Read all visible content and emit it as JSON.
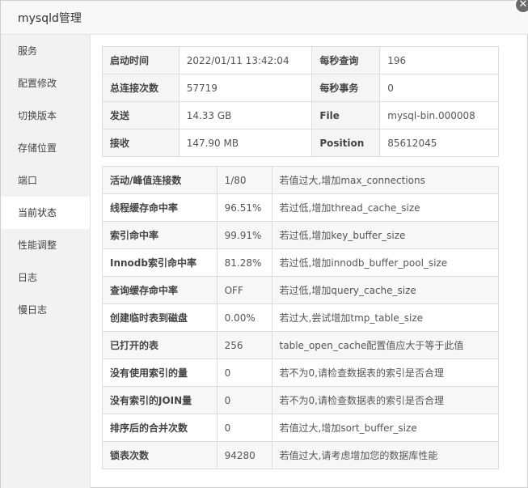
{
  "title": "mysqld管理",
  "close_glyph": "✕",
  "sidebar": {
    "items": [
      {
        "label": "服务"
      },
      {
        "label": "配置修改"
      },
      {
        "label": "切换版本"
      },
      {
        "label": "存储位置"
      },
      {
        "label": "端口"
      },
      {
        "label": "当前状态"
      },
      {
        "label": "性能调整"
      },
      {
        "label": "日志"
      },
      {
        "label": "慢日志"
      }
    ],
    "active_index": 5
  },
  "summary": [
    [
      "启动时间",
      "2022/01/11 13:42:04",
      "每秒查询",
      "196"
    ],
    [
      "总连接次数",
      "57719",
      "每秒事务",
      "0"
    ],
    [
      "发送",
      "14.33 GB",
      "File",
      "mysql-bin.000008"
    ],
    [
      "接收",
      "147.90 MB",
      "Position",
      "85612045"
    ]
  ],
  "metrics": [
    [
      "活动/峰值连接数",
      "1/80",
      "若值过大,增加max_connections"
    ],
    [
      "线程缓存命中率",
      "96.51%",
      "若过低,增加thread_cache_size"
    ],
    [
      "索引命中率",
      "99.91%",
      "若过低,增加key_buffer_size"
    ],
    [
      "Innodb索引命中率",
      "81.28%",
      "若过低,增加innodb_buffer_pool_size"
    ],
    [
      "查询缓存命中率",
      "OFF",
      "若过低,增加query_cache_size"
    ],
    [
      "创建临时表到磁盘",
      "0.00%",
      "若过大,尝试增加tmp_table_size"
    ],
    [
      "已打开的表",
      "256",
      "table_open_cache配置值应大于等于此值"
    ],
    [
      "没有使用索引的量",
      "0",
      "若不为0,请检查数据表的索引是否合理"
    ],
    [
      "没有索引的JOIN量",
      "0",
      "若不为0,请检查数据表的索引是否合理"
    ],
    [
      "排序后的合并次数",
      "0",
      "若值过大,增加sort_buffer_size"
    ],
    [
      "锁表次数",
      "94280",
      "若值过大,请考虑增加您的数据库性能"
    ]
  ]
}
